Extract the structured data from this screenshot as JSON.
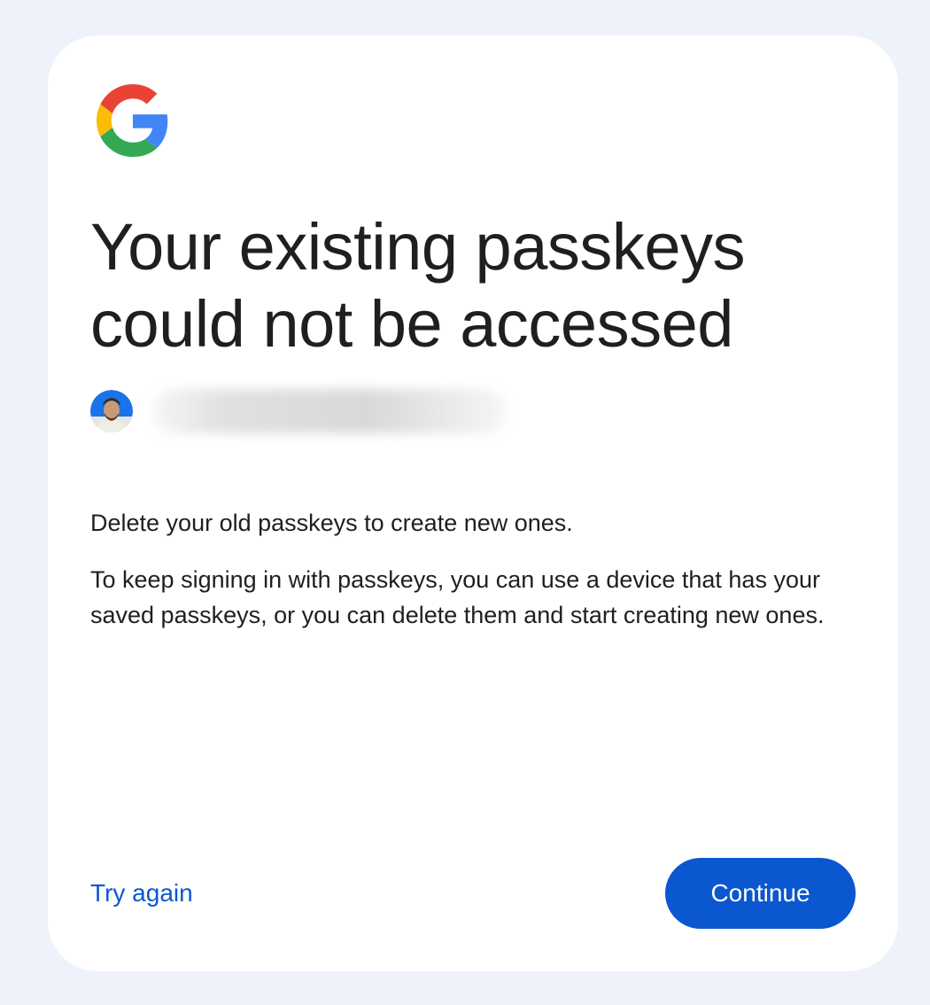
{
  "dialog": {
    "title": "Your existing passkeys could not be accessed",
    "account": {
      "avatar_icon": "user-avatar-photo",
      "email_redacted": true
    },
    "message_primary": "Delete your old passkeys to create new ones.",
    "message_secondary": "To keep signing in with passkeys, you can use a device that has your saved passkeys, or you can delete them and start creating new ones.",
    "secondary_action_label": "Try again",
    "primary_action_label": "Continue"
  },
  "colors": {
    "page_background": "#eef2fa",
    "card_background": "#ffffff",
    "accent": "#0b57d0",
    "text": "#1f1f1f"
  },
  "icons": {
    "logo": "google-g-logo-icon"
  }
}
